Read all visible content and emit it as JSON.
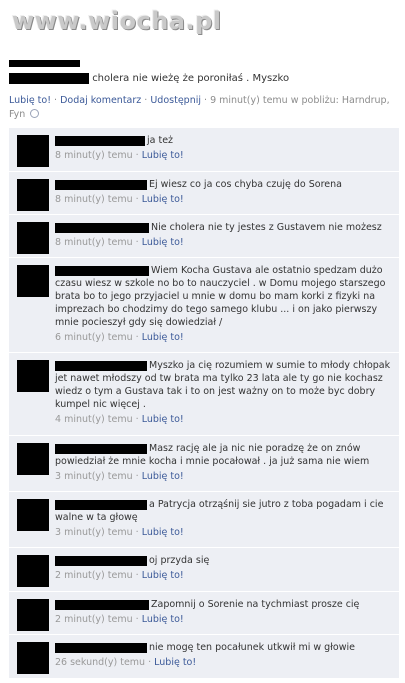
{
  "watermark": "www.wiocha.pl",
  "post": {
    "text": "cholera nie wieżę że poroniłaś . Myszko",
    "actions": {
      "like": "Lubię to!",
      "comment": "Dodaj komentarz",
      "share": "Udostępnij",
      "time": "9 minut(y) temu w pobliżu: Harndrup, Fyn"
    }
  },
  "comments": [
    {
      "text": "ja też",
      "time": "8 minut(y) temu",
      "like": "Lubię to!"
    },
    {
      "text": "Ej wiesz co ja cos chyba czuję do Sorena",
      "time": "8 minut(y) temu",
      "like": "Lubię to!"
    },
    {
      "text": "Nie cholera nie ty jestes z Gustavem nie możesz",
      "time": "8 minut(y) temu",
      "like": "Lubię to!"
    },
    {
      "text": "Wiem Kocha Gustava ale ostatnio spedzam dużo czasu wiesz w szkole no bo to nauczyciel . w Domu mojego starszego brata bo to jego przyjaciel u mnie w domu bo mam korki z fizyki na imprezach bo chodzimy do tego samego klubu ... i on jako pierwszy mnie pocieszył gdy się dowiedział /",
      "time": "6 minut(y) temu",
      "like": "Lubię to!"
    },
    {
      "text": "Myszko ja cię rozumiem w sumie to młody chłopak jet nawet młodszy od tw brata ma tylko 23 lata ale ty go nie kochasz wiedz o tym a Gustava tak i to on jest ważny on to może byc dobry kumpel nic więcej .",
      "time": "4 minut(y) temu",
      "like": "Lubię to!"
    },
    {
      "text": "Masz rację ale ja nic nie poradzę że on znów powiedział że mnie kocha i mnie pocałował . ja już sama nie wiem",
      "time": "3 minut(y) temu",
      "like": "Lubię to!"
    },
    {
      "text": "a Patrycja otrząśnij sie jutro z toba pogadam i cie walne w ta głowę",
      "time": "3 minut(y) temu",
      "like": "Lubię to!"
    },
    {
      "text": "oj przyda się",
      "time": "2 minut(y) temu",
      "like": "Lubię to!"
    },
    {
      "text": "Zapomnij o Sorenie na tychmiast prosze cię",
      "time": "2 minut(y) temu",
      "like": "Lubię to!"
    },
    {
      "text": "nie mogę ten pocałunek utkwił mi w głowie",
      "time": "26 sekund(y) temu",
      "like": "Lubię to!"
    }
  ]
}
